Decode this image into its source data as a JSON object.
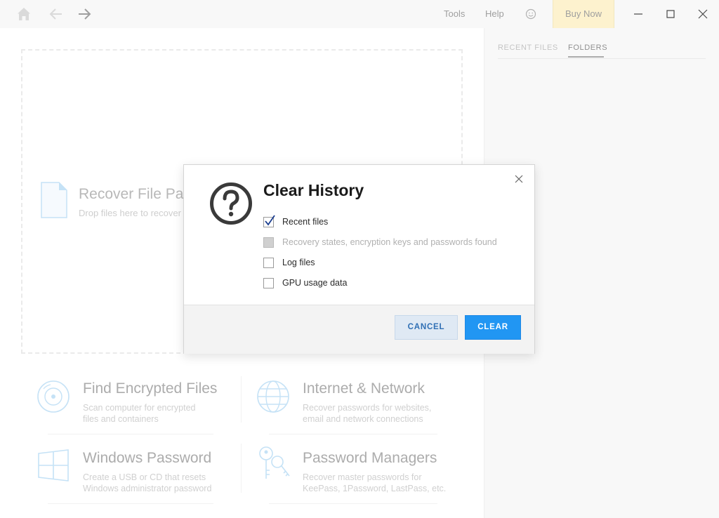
{
  "titlebar": {
    "tools_label": "Tools",
    "help_label": "Help",
    "buy_now_label": "Buy Now",
    "accent_buy_now": "#fdf0c4"
  },
  "right_panel": {
    "tabs": [
      {
        "label": "RECENT FILES",
        "active": false
      },
      {
        "label": "FOLDERS",
        "active": true
      }
    ]
  },
  "dropzone": {
    "title": "Recover File Pass",
    "subtitle": "Drop files here to recover"
  },
  "cards": [
    {
      "title": "Find Encrypted Files",
      "line1": "Scan computer for encrypted",
      "line2": "files and containers",
      "icon": "disc-scan-icon"
    },
    {
      "title": "Internet & Network",
      "line1": "Recover passwords for websites,",
      "line2": "email and network connections",
      "icon": "globe-icon"
    },
    {
      "title": "Windows Password",
      "line1": "Create a USB or CD that resets",
      "line2": "Windows administrator password",
      "icon": "windows-logo-icon"
    },
    {
      "title": "Password Managers",
      "line1": "Recover master passwords for",
      "line2": "KeePass, 1Password, LastPass, etc.",
      "icon": "keys-icon"
    }
  ],
  "modal": {
    "title": "Clear History",
    "options": [
      {
        "label": "Recent files",
        "checked": true,
        "disabled": false
      },
      {
        "label": "Recovery states, encryption keys and passwords found",
        "checked": false,
        "disabled": true
      },
      {
        "label": "Log files",
        "checked": false,
        "disabled": false
      },
      {
        "label": "GPU usage data",
        "checked": false,
        "disabled": false
      }
    ],
    "cancel_label": "CANCEL",
    "clear_label": "CLEAR",
    "accent_primary": "#2196f3"
  }
}
